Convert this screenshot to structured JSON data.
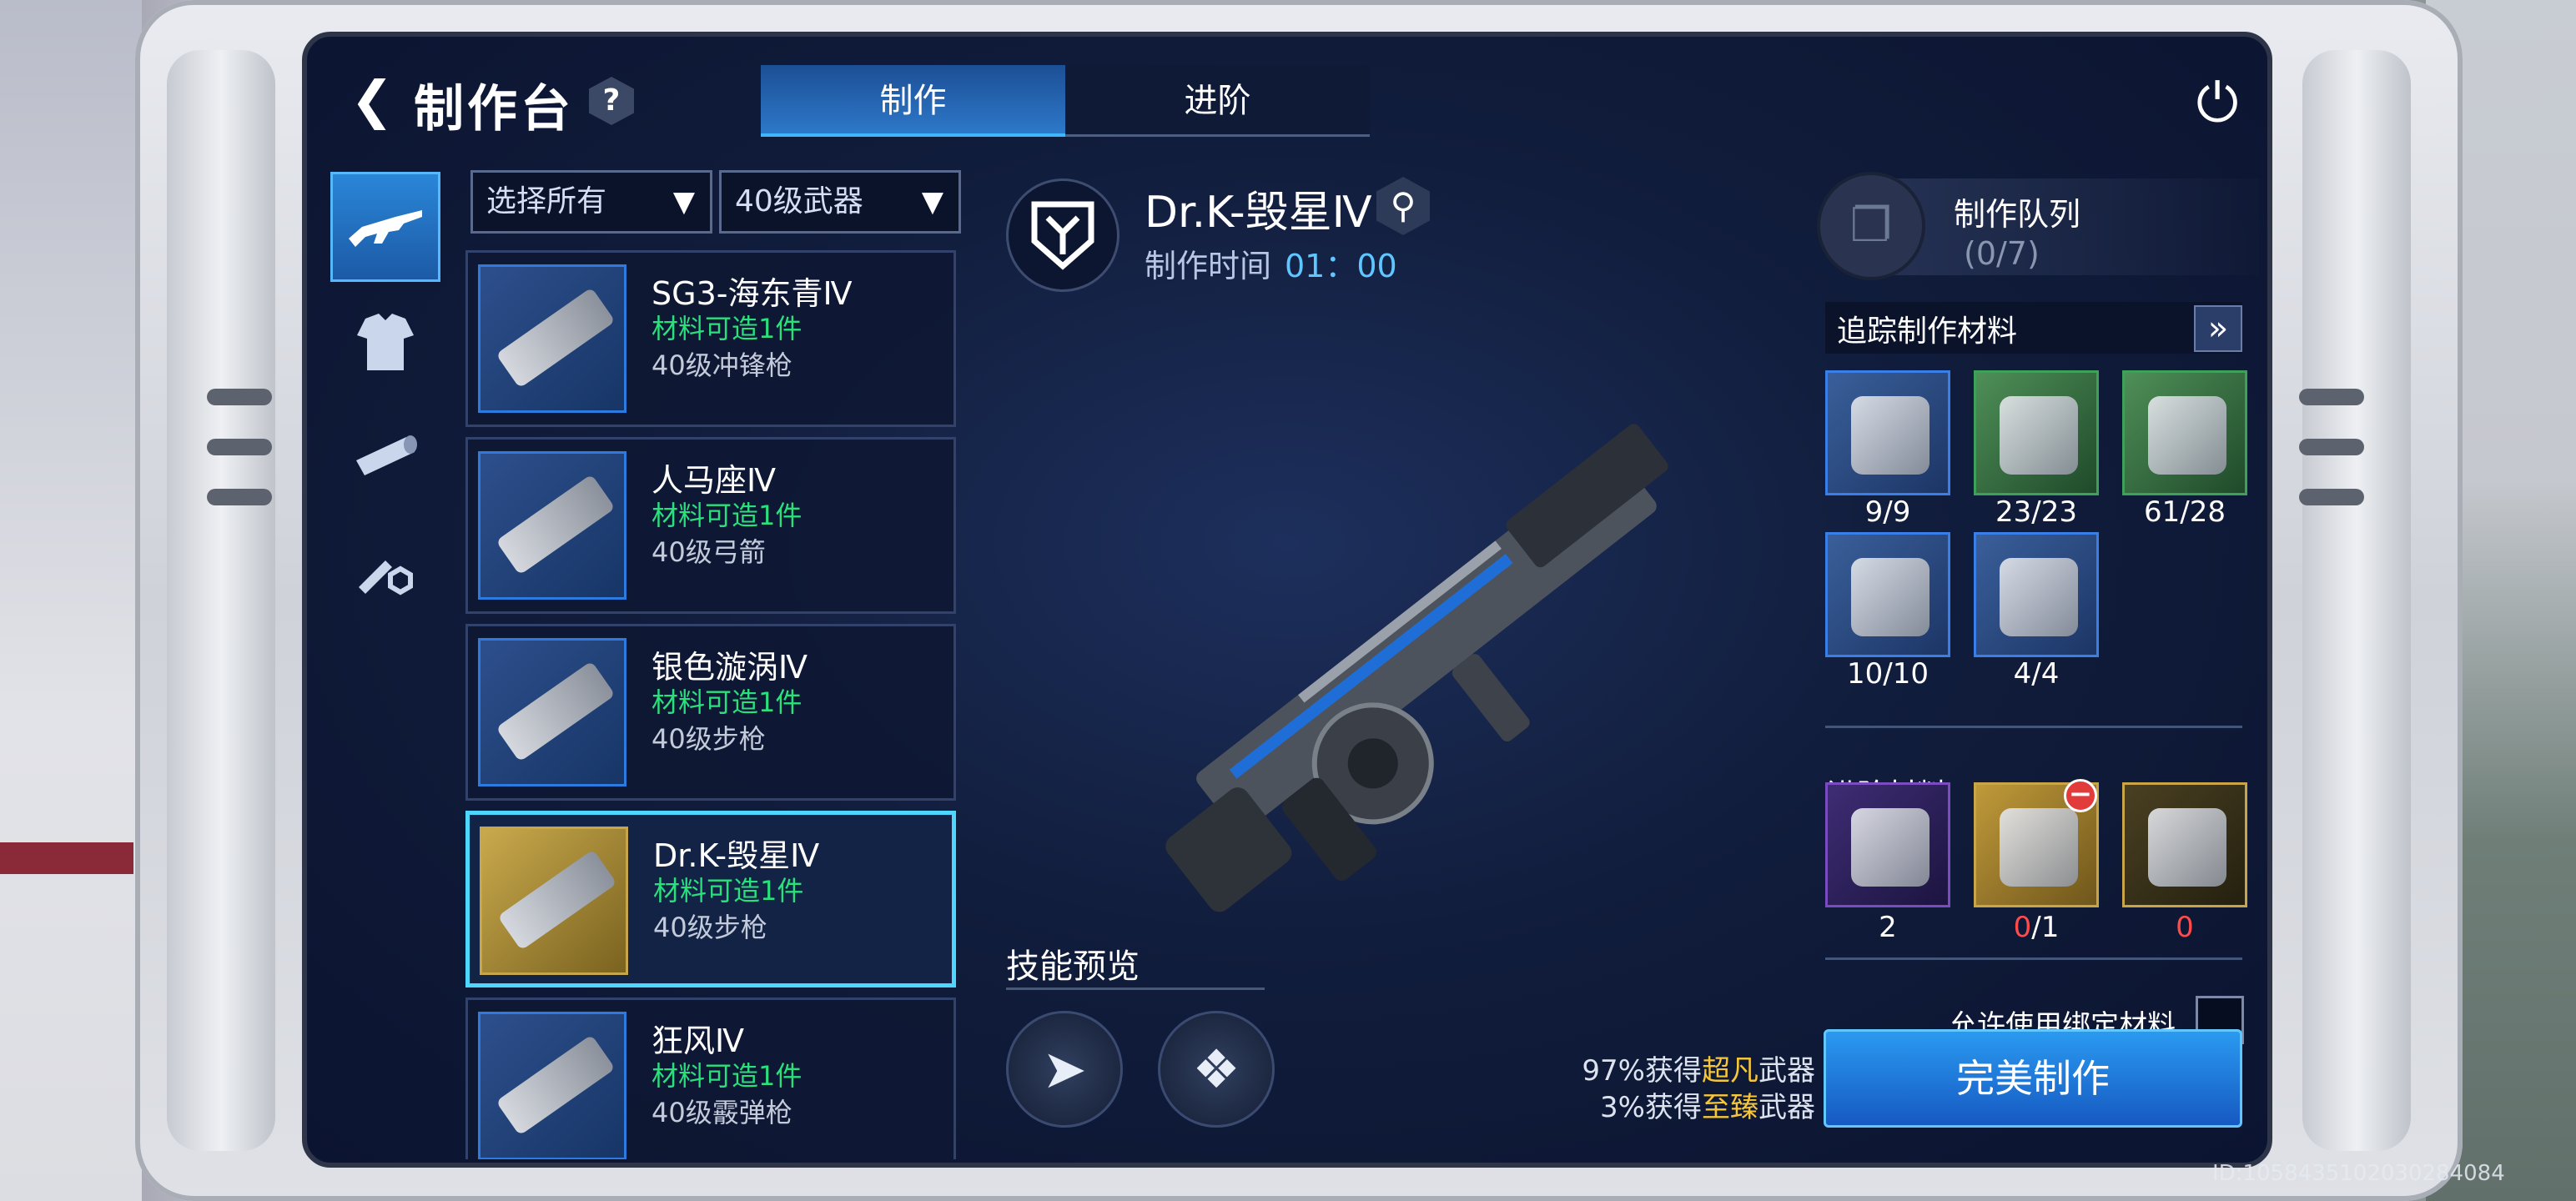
{
  "header": {
    "back_icon": "back-arrow-icon",
    "title": "制作台",
    "help": "?",
    "tabs": [
      {
        "label": "制作",
        "active": true
      },
      {
        "label": "进阶",
        "active": false
      }
    ],
    "power_icon": "power-icon"
  },
  "categories": [
    {
      "icon": "rifle-icon",
      "active": true
    },
    {
      "icon": "armor-icon",
      "active": false
    },
    {
      "icon": "attachment-icon",
      "active": false
    },
    {
      "icon": "tools-icon",
      "active": false
    }
  ],
  "filters": {
    "type": "选择所有",
    "level": "40级武器"
  },
  "weapons": [
    {
      "name": "SG3-海东青Ⅳ",
      "mat": "材料可造1件",
      "lvl": "40级冲锋枪",
      "selected": false
    },
    {
      "name": "人马座Ⅳ",
      "mat": "材料可造1件",
      "lvl": "40级弓箭",
      "selected": false
    },
    {
      "name": "银色漩涡Ⅳ",
      "mat": "材料可造1件",
      "lvl": "40级步枪",
      "selected": false
    },
    {
      "name": "Dr.K-毁星Ⅳ",
      "mat": "材料可造1件",
      "lvl": "40级步枪",
      "selected": true
    },
    {
      "name": "狂风Ⅳ",
      "mat": "材料可造1件",
      "lvl": "40级霰弹枪",
      "selected": false
    }
  ],
  "detail": {
    "name": "Dr.K-毁星Ⅳ",
    "craft_time_label": "制作时间",
    "craft_time": "01：00",
    "skill_title": "技能预览",
    "chance1": {
      "pct": "97%获得",
      "grade": "超凡",
      "suffix": "武器"
    },
    "chance2": {
      "pct": "3%获得",
      "grade": "至臻",
      "suffix": "武器"
    }
  },
  "queue": {
    "label": "制作队列",
    "count": "(0/7)"
  },
  "tracking": {
    "label": "追踪制作材料",
    "materials": [
      {
        "count": "9/9",
        "style": "blue"
      },
      {
        "count": "23/23",
        "style": "green"
      },
      {
        "count": "61/28",
        "style": "green"
      },
      {
        "count": "10/10",
        "style": "blue"
      },
      {
        "count": "4/4",
        "style": "blue"
      }
    ]
  },
  "advance": {
    "label": "进阶材料",
    "items": [
      {
        "count": "2",
        "style": "purple"
      },
      {
        "count_have": "0",
        "count_need": "/1",
        "style": "gold"
      },
      {
        "count": "0",
        "style": "goldline"
      }
    ]
  },
  "bind_label": "允许使用绑定材料",
  "craft_button": "完美制作",
  "uid": "ID:10584351020302840​84"
}
